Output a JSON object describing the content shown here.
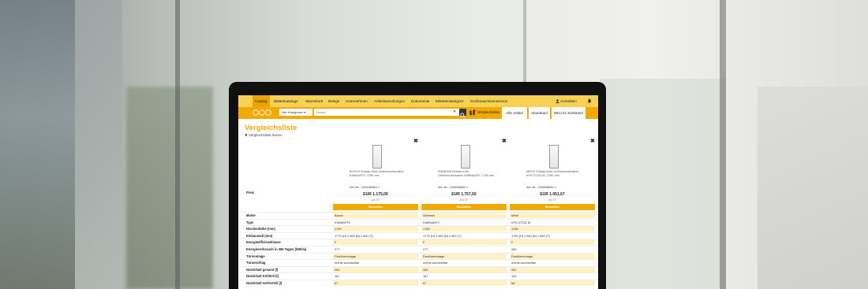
{
  "topnav": {
    "items": [
      "Katalog",
      "Blätterkataloge",
      "Warenkorb",
      "Belege",
      "Unternehmen",
      "Artikelsammlungen",
      "Dokumente",
      "Etikettendesigner",
      "Großmaschinenservice"
    ],
    "login": "Anmelden"
  },
  "subbar": {
    "category": "Alle Kategorien",
    "search_placeholder": "Suche",
    "compare": "Vergleichsliste",
    "tabs": [
      "Alle Artikel",
      "Abverkauf",
      "NEU im Sortiment"
    ]
  },
  "page": {
    "title": "Vergleichsliste",
    "clear": "Vergleichsliste leeren"
  },
  "products": [
    {
      "name": "BOSCH Einbau-Kühl-Gefrierkombination KIN86VFF0, 1780 mm",
      "art": "Art.-Nr.: 112546483 »",
      "price": "EUR 1.175,00",
      "unit": "pro ST",
      "order": "Bestellen",
      "marke": "Bosch",
      "typ": "KIN86VFF0",
      "nischenhoehe": "1780",
      "einbaumass": "1775 (H) x 560 (B) x 550 (T)",
      "energie": "F",
      "verbrauch": "277",
      "tuermontage": "Festtürmontage",
      "tueranschlag": "rechts wechselbar",
      "gesamt": "254",
      "kuehlteil": "187",
      "gefrierteil": "67"
    },
    {
      "name": "SIEMENS Einbau-Kühl-Gefrierkombination KI86NADF0, 1780 mm",
      "art": "Art.-Nr.: 112553839 »",
      "price": "EUR 1.757,50",
      "unit": "pro ST",
      "order": "Bestellen",
      "marke": "Siemens",
      "typ": "KI86NADF0",
      "nischenhoehe": "1780",
      "einbaumass": "1775 (H) x 560 (B) x 550 (T)",
      "energie": "F",
      "verbrauch": "277",
      "tuermontage": "Festtürmontage",
      "tueranschlag": "rechts wechselbar",
      "gesamt": "254",
      "kuehlteil": "187",
      "gefrierteil": "67"
    },
    {
      "name": "MIELE Einbau-Kühl-Gefrierkombination KFN 37232 iD, 1780 mm",
      "art": "Art.-Nr.: 112558545 »",
      "price": "EUR 1.051,67",
      "unit": "pro ST",
      "order": "Bestellen",
      "marke": "Miele",
      "typ": "KFN 37232 iD",
      "nischenhoehe": "1780",
      "einbaumass": "1780 (H) x 560 (B) x 550 (T)",
      "energie": "F",
      "verbrauch": "280",
      "tuermontage": "Festtürmontage",
      "tueranschlag": "rechts wechselbar",
      "gesamt": "262",
      "kuehlteil": "194",
      "gefrierteil": "68"
    }
  ],
  "labels": {
    "preis": "Preis",
    "marke": "Marke",
    "typ": "Type",
    "nischenhoehe": "Nischenhöhe (mm)",
    "einbaumass": "Einbaumaß (mm)",
    "energie": "Energieeffizienzklasse",
    "verbrauch": "Energieverbrauch in 365 Tagen (kWh/a)",
    "tuermontage": "Türmontage",
    "tueranschlag": "Türanschlag",
    "gesamt": "Nutzinhalt gesamt (l)",
    "kuehlteil": "Nutzinhalt Kühlteil (l)",
    "gefrierteil": "Nutzinhalt Gefrierteil (l)"
  }
}
